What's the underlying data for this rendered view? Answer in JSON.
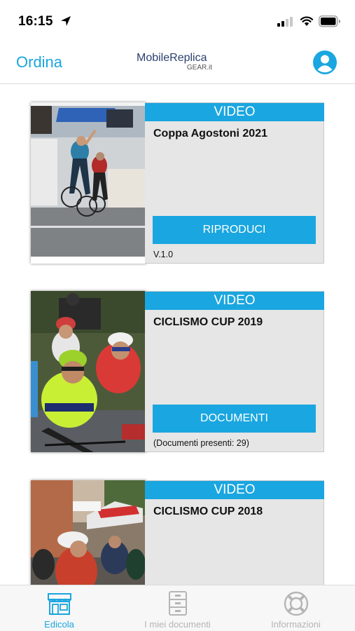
{
  "status_bar": {
    "time": "16:15",
    "icons": [
      "location-arrow-icon",
      "cellular-signal-icon",
      "wifi-icon",
      "battery-icon"
    ]
  },
  "header": {
    "left_action": "Ordina",
    "brand_title": "MobileReplica",
    "brand_subtitle": "GEAR.it",
    "right_icon": "user-profile-icon"
  },
  "colors": {
    "accent": "#1aa6e0",
    "panel": "#e6e6e6",
    "brand_text": "#2a3f6e"
  },
  "cards": [
    {
      "tag": "VIDEO",
      "title": "Coppa Agostoni 2021",
      "button": "RIPRODUCI",
      "note": "V.1.0",
      "image": "cyclist-finish-line-photo"
    },
    {
      "tag": "VIDEO",
      "title": "CICLISMO CUP 2019",
      "button": "DOCUMENTI",
      "note": "(Documenti presenti: 29)",
      "image": "cyclists-racing-photo"
    },
    {
      "tag": "VIDEO",
      "title": "CICLISMO CUP 2018",
      "button": "",
      "note": "",
      "image": "cyclists-street-race-photo"
    }
  ],
  "tabs": [
    {
      "label": "Edicola",
      "icon": "newsstand-icon",
      "active": true
    },
    {
      "label": "I miei documenti",
      "icon": "filing-cabinet-icon",
      "active": false
    },
    {
      "label": "Informazioni",
      "icon": "lifebuoy-icon",
      "active": false
    }
  ]
}
